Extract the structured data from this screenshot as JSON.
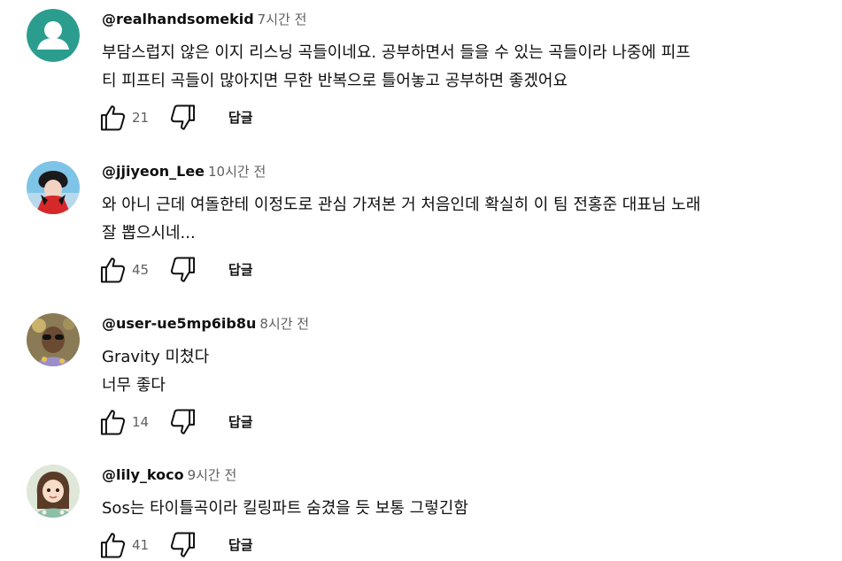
{
  "colors": {
    "text_primary": "#0f0f0f",
    "text_secondary": "#606060",
    "default_avatar_bg": "#2a9d8f"
  },
  "comments": [
    {
      "author": "@realhandsomekid",
      "time": "7시간 전",
      "text_lines": [
        "부담스럽지 않은 이지 리스닝 곡들이네요.  공부하면서 들을 수 있는 곡들이라 나중에 피프",
        "티 피프티 곡들이 많아지면 무한 반복으로 틀어놓고 공부하면 좋겠어요"
      ],
      "likes": "21",
      "reply_label": "답글",
      "avatar_icon": "default-person-avatar"
    },
    {
      "author": "@jjiyeon_Lee",
      "time": "10시간 전",
      "text_lines": [
        "와 아니 근데 여돌한테 이정도로 관심 가져본 거 처음인데 확실히 이 팀 전홍준 대표님 노래",
        "잘 뽑으시네..."
      ],
      "likes": "45",
      "reply_label": "답글",
      "avatar_icon": "photo-avatar"
    },
    {
      "author": "@user-ue5mp6ib8u",
      "time": "8시간 전",
      "text_lines": [
        "Gravity 미쳤다",
        "너무 좋다"
      ],
      "likes": "14",
      "reply_label": "답글",
      "avatar_icon": "photo-avatar"
    },
    {
      "author": "@lily_koco",
      "time": "9시간 전",
      "text_lines": [
        "Sos는 타이틀곡이라 킬링파트 숨겼을 듯 보통 그렇긴함"
      ],
      "likes": "41",
      "reply_label": "답글",
      "avatar_icon": "illustrated-avatar"
    }
  ],
  "icons": {
    "like": "thumb-up-icon",
    "dislike": "thumb-down-icon"
  }
}
